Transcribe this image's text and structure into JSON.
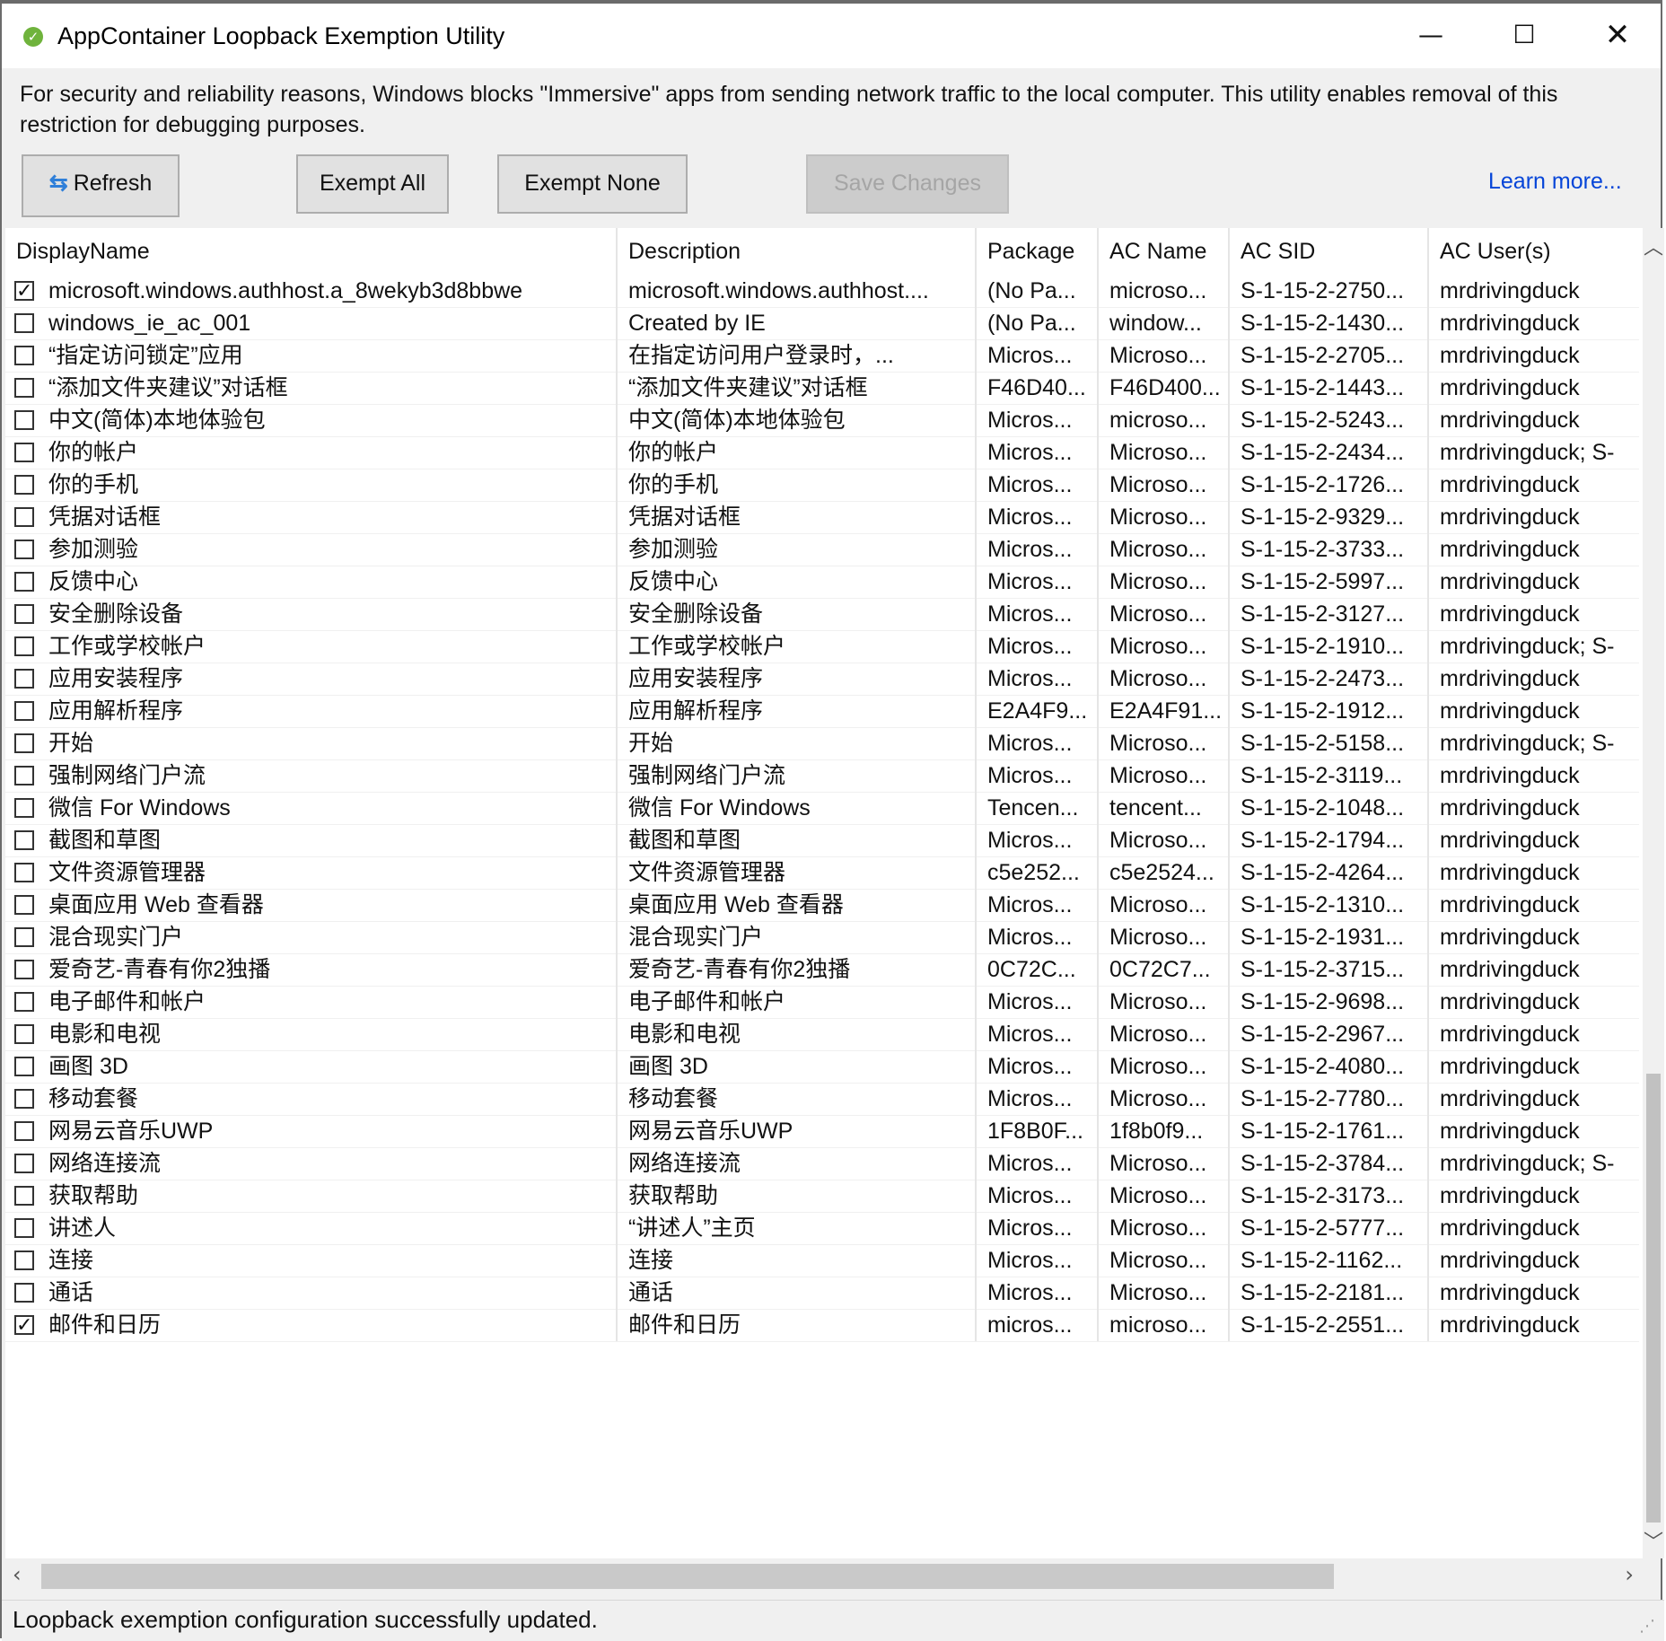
{
  "window": {
    "title": "AppContainer Loopback Exemption Utility",
    "controls": {
      "minimize": "—",
      "maximize": "☐",
      "close": "✕"
    }
  },
  "description": "For security and reliability reasons, Windows blocks \"Immersive\" apps from sending network traffic to the local computer. This utility enables removal of this restriction for debugging purposes.",
  "toolbar": {
    "refresh": "Refresh",
    "exempt_all": "Exempt All",
    "exempt_none": "Exempt None",
    "save_changes": "Save Changes",
    "learn_more": "Learn more..."
  },
  "table": {
    "columns": [
      "DisplayName",
      "Description",
      "Package",
      "AC Name",
      "AC SID",
      "AC User(s)"
    ],
    "rows": [
      {
        "checked": true,
        "display": "microsoft.windows.authhost.a_8wekyb3d8bbwe",
        "desc": "microsoft.windows.authhost....",
        "pkg": "(No Pa...",
        "acn": "microso...",
        "sid": "S-1-15-2-2750...",
        "user": "mrdrivingduck"
      },
      {
        "checked": false,
        "display": "windows_ie_ac_001",
        "desc": "Created by IE",
        "pkg": "(No Pa...",
        "acn": "window...",
        "sid": "S-1-15-2-1430...",
        "user": "mrdrivingduck"
      },
      {
        "checked": false,
        "display": "“指定访问锁定”应用",
        "desc": "在指定访问用户登录时，...",
        "pkg": "Micros...",
        "acn": "Microso...",
        "sid": "S-1-15-2-2705...",
        "user": "mrdrivingduck"
      },
      {
        "checked": false,
        "display": "“添加文件夹建议”对话框",
        "desc": "“添加文件夹建议”对话框",
        "pkg": "F46D40...",
        "acn": "F46D400...",
        "sid": "S-1-15-2-1443...",
        "user": "mrdrivingduck"
      },
      {
        "checked": false,
        "display": "中文(简体)本地体验包",
        "desc": "中文(简体)本地体验包",
        "pkg": "Micros...",
        "acn": "microso...",
        "sid": "S-1-15-2-5243...",
        "user": "mrdrivingduck"
      },
      {
        "checked": false,
        "display": "你的帐户",
        "desc": "你的帐户",
        "pkg": "Micros...",
        "acn": "Microso...",
        "sid": "S-1-15-2-2434...",
        "user": "mrdrivingduck; S-"
      },
      {
        "checked": false,
        "display": "你的手机",
        "desc": "你的手机",
        "pkg": "Micros...",
        "acn": "Microso...",
        "sid": "S-1-15-2-1726...",
        "user": "mrdrivingduck"
      },
      {
        "checked": false,
        "display": "凭据对话框",
        "desc": "凭据对话框",
        "pkg": "Micros...",
        "acn": "Microso...",
        "sid": "S-1-15-2-9329...",
        "user": "mrdrivingduck"
      },
      {
        "checked": false,
        "display": "参加测验",
        "desc": "参加测验",
        "pkg": "Micros...",
        "acn": "Microso...",
        "sid": "S-1-15-2-3733...",
        "user": "mrdrivingduck"
      },
      {
        "checked": false,
        "display": "反馈中心",
        "desc": "反馈中心",
        "pkg": "Micros...",
        "acn": "Microso...",
        "sid": "S-1-15-2-5997...",
        "user": "mrdrivingduck"
      },
      {
        "checked": false,
        "display": "安全删除设备",
        "desc": "安全删除设备",
        "pkg": "Micros...",
        "acn": "Microso...",
        "sid": "S-1-15-2-3127...",
        "user": "mrdrivingduck"
      },
      {
        "checked": false,
        "display": "工作或学校帐户",
        "desc": "工作或学校帐户",
        "pkg": "Micros...",
        "acn": "Microso...",
        "sid": "S-1-15-2-1910...",
        "user": "mrdrivingduck; S-"
      },
      {
        "checked": false,
        "display": "应用安装程序",
        "desc": "应用安装程序",
        "pkg": "Micros...",
        "acn": "Microso...",
        "sid": "S-1-15-2-2473...",
        "user": "mrdrivingduck"
      },
      {
        "checked": false,
        "display": "应用解析程序",
        "desc": "应用解析程序",
        "pkg": "E2A4F9...",
        "acn": "E2A4F91...",
        "sid": "S-1-15-2-1912...",
        "user": "mrdrivingduck"
      },
      {
        "checked": false,
        "display": "开始",
        "desc": "开始",
        "pkg": "Micros...",
        "acn": "Microso...",
        "sid": "S-1-15-2-5158...",
        "user": "mrdrivingduck; S-"
      },
      {
        "checked": false,
        "display": "强制网络门户流",
        "desc": "强制网络门户流",
        "pkg": "Micros...",
        "acn": "Microso...",
        "sid": "S-1-15-2-3119...",
        "user": "mrdrivingduck"
      },
      {
        "checked": false,
        "display": "微信 For Windows",
        "desc": "微信 For Windows",
        "pkg": "Tencen...",
        "acn": "tencent...",
        "sid": "S-1-15-2-1048...",
        "user": "mrdrivingduck"
      },
      {
        "checked": false,
        "display": "截图和草图",
        "desc": "截图和草图",
        "pkg": "Micros...",
        "acn": "Microso...",
        "sid": "S-1-15-2-1794...",
        "user": "mrdrivingduck"
      },
      {
        "checked": false,
        "display": "文件资源管理器",
        "desc": "文件资源管理器",
        "pkg": "c5e252...",
        "acn": "c5e2524...",
        "sid": "S-1-15-2-4264...",
        "user": "mrdrivingduck"
      },
      {
        "checked": false,
        "display": "桌面应用 Web 查看器",
        "desc": "桌面应用 Web 查看器",
        "pkg": "Micros...",
        "acn": "Microso...",
        "sid": "S-1-15-2-1310...",
        "user": "mrdrivingduck"
      },
      {
        "checked": false,
        "display": "混合现实门户",
        "desc": "混合现实门户",
        "pkg": "Micros...",
        "acn": "Microso...",
        "sid": "S-1-15-2-1931...",
        "user": "mrdrivingduck"
      },
      {
        "checked": false,
        "display": "爱奇艺-青春有你2独播",
        "desc": "爱奇艺-青春有你2独播",
        "pkg": "0C72C...",
        "acn": "0C72C7...",
        "sid": "S-1-15-2-3715...",
        "user": "mrdrivingduck"
      },
      {
        "checked": false,
        "display": "电子邮件和帐户",
        "desc": "电子邮件和帐户",
        "pkg": "Micros...",
        "acn": "Microso...",
        "sid": "S-1-15-2-9698...",
        "user": "mrdrivingduck"
      },
      {
        "checked": false,
        "display": "电影和电视",
        "desc": "电影和电视",
        "pkg": "Micros...",
        "acn": "Microso...",
        "sid": "S-1-15-2-2967...",
        "user": "mrdrivingduck"
      },
      {
        "checked": false,
        "display": "画图 3D",
        "desc": "画图 3D",
        "pkg": "Micros...",
        "acn": "Microso...",
        "sid": "S-1-15-2-4080...",
        "user": "mrdrivingduck"
      },
      {
        "checked": false,
        "display": "移动套餐",
        "desc": "移动套餐",
        "pkg": "Micros...",
        "acn": "Microso...",
        "sid": "S-1-15-2-7780...",
        "user": "mrdrivingduck"
      },
      {
        "checked": false,
        "display": "网易云音乐UWP",
        "desc": "网易云音乐UWP",
        "pkg": "1F8B0F...",
        "acn": "1f8b0f9...",
        "sid": "S-1-15-2-1761...",
        "user": "mrdrivingduck"
      },
      {
        "checked": false,
        "display": "网络连接流",
        "desc": "网络连接流",
        "pkg": "Micros...",
        "acn": "Microso...",
        "sid": "S-1-15-2-3784...",
        "user": "mrdrivingduck; S-"
      },
      {
        "checked": false,
        "display": "获取帮助",
        "desc": "获取帮助",
        "pkg": "Micros...",
        "acn": "Microso...",
        "sid": "S-1-15-2-3173...",
        "user": "mrdrivingduck"
      },
      {
        "checked": false,
        "display": "讲述人",
        "desc": "“讲述人”主页",
        "pkg": "Micros...",
        "acn": "Microso...",
        "sid": "S-1-15-2-5777...",
        "user": "mrdrivingduck"
      },
      {
        "checked": false,
        "display": "连接",
        "desc": "连接",
        "pkg": "Micros...",
        "acn": "Microso...",
        "sid": "S-1-15-2-1162...",
        "user": "mrdrivingduck"
      },
      {
        "checked": false,
        "display": "通话",
        "desc": "通话",
        "pkg": "Micros...",
        "acn": "Microso...",
        "sid": "S-1-15-2-2181...",
        "user": "mrdrivingduck"
      },
      {
        "checked": true,
        "display": "邮件和日历",
        "desc": "邮件和日历",
        "pkg": "micros...",
        "acn": "microso...",
        "sid": "S-1-15-2-2551...",
        "user": "mrdrivingduck"
      }
    ]
  },
  "status": {
    "text": "Loopback exemption configuration successfully updated."
  },
  "colors": {
    "link": "#0645d8",
    "accent_icon": "#6fb33c",
    "refresh_icon": "#2f7fd9"
  }
}
